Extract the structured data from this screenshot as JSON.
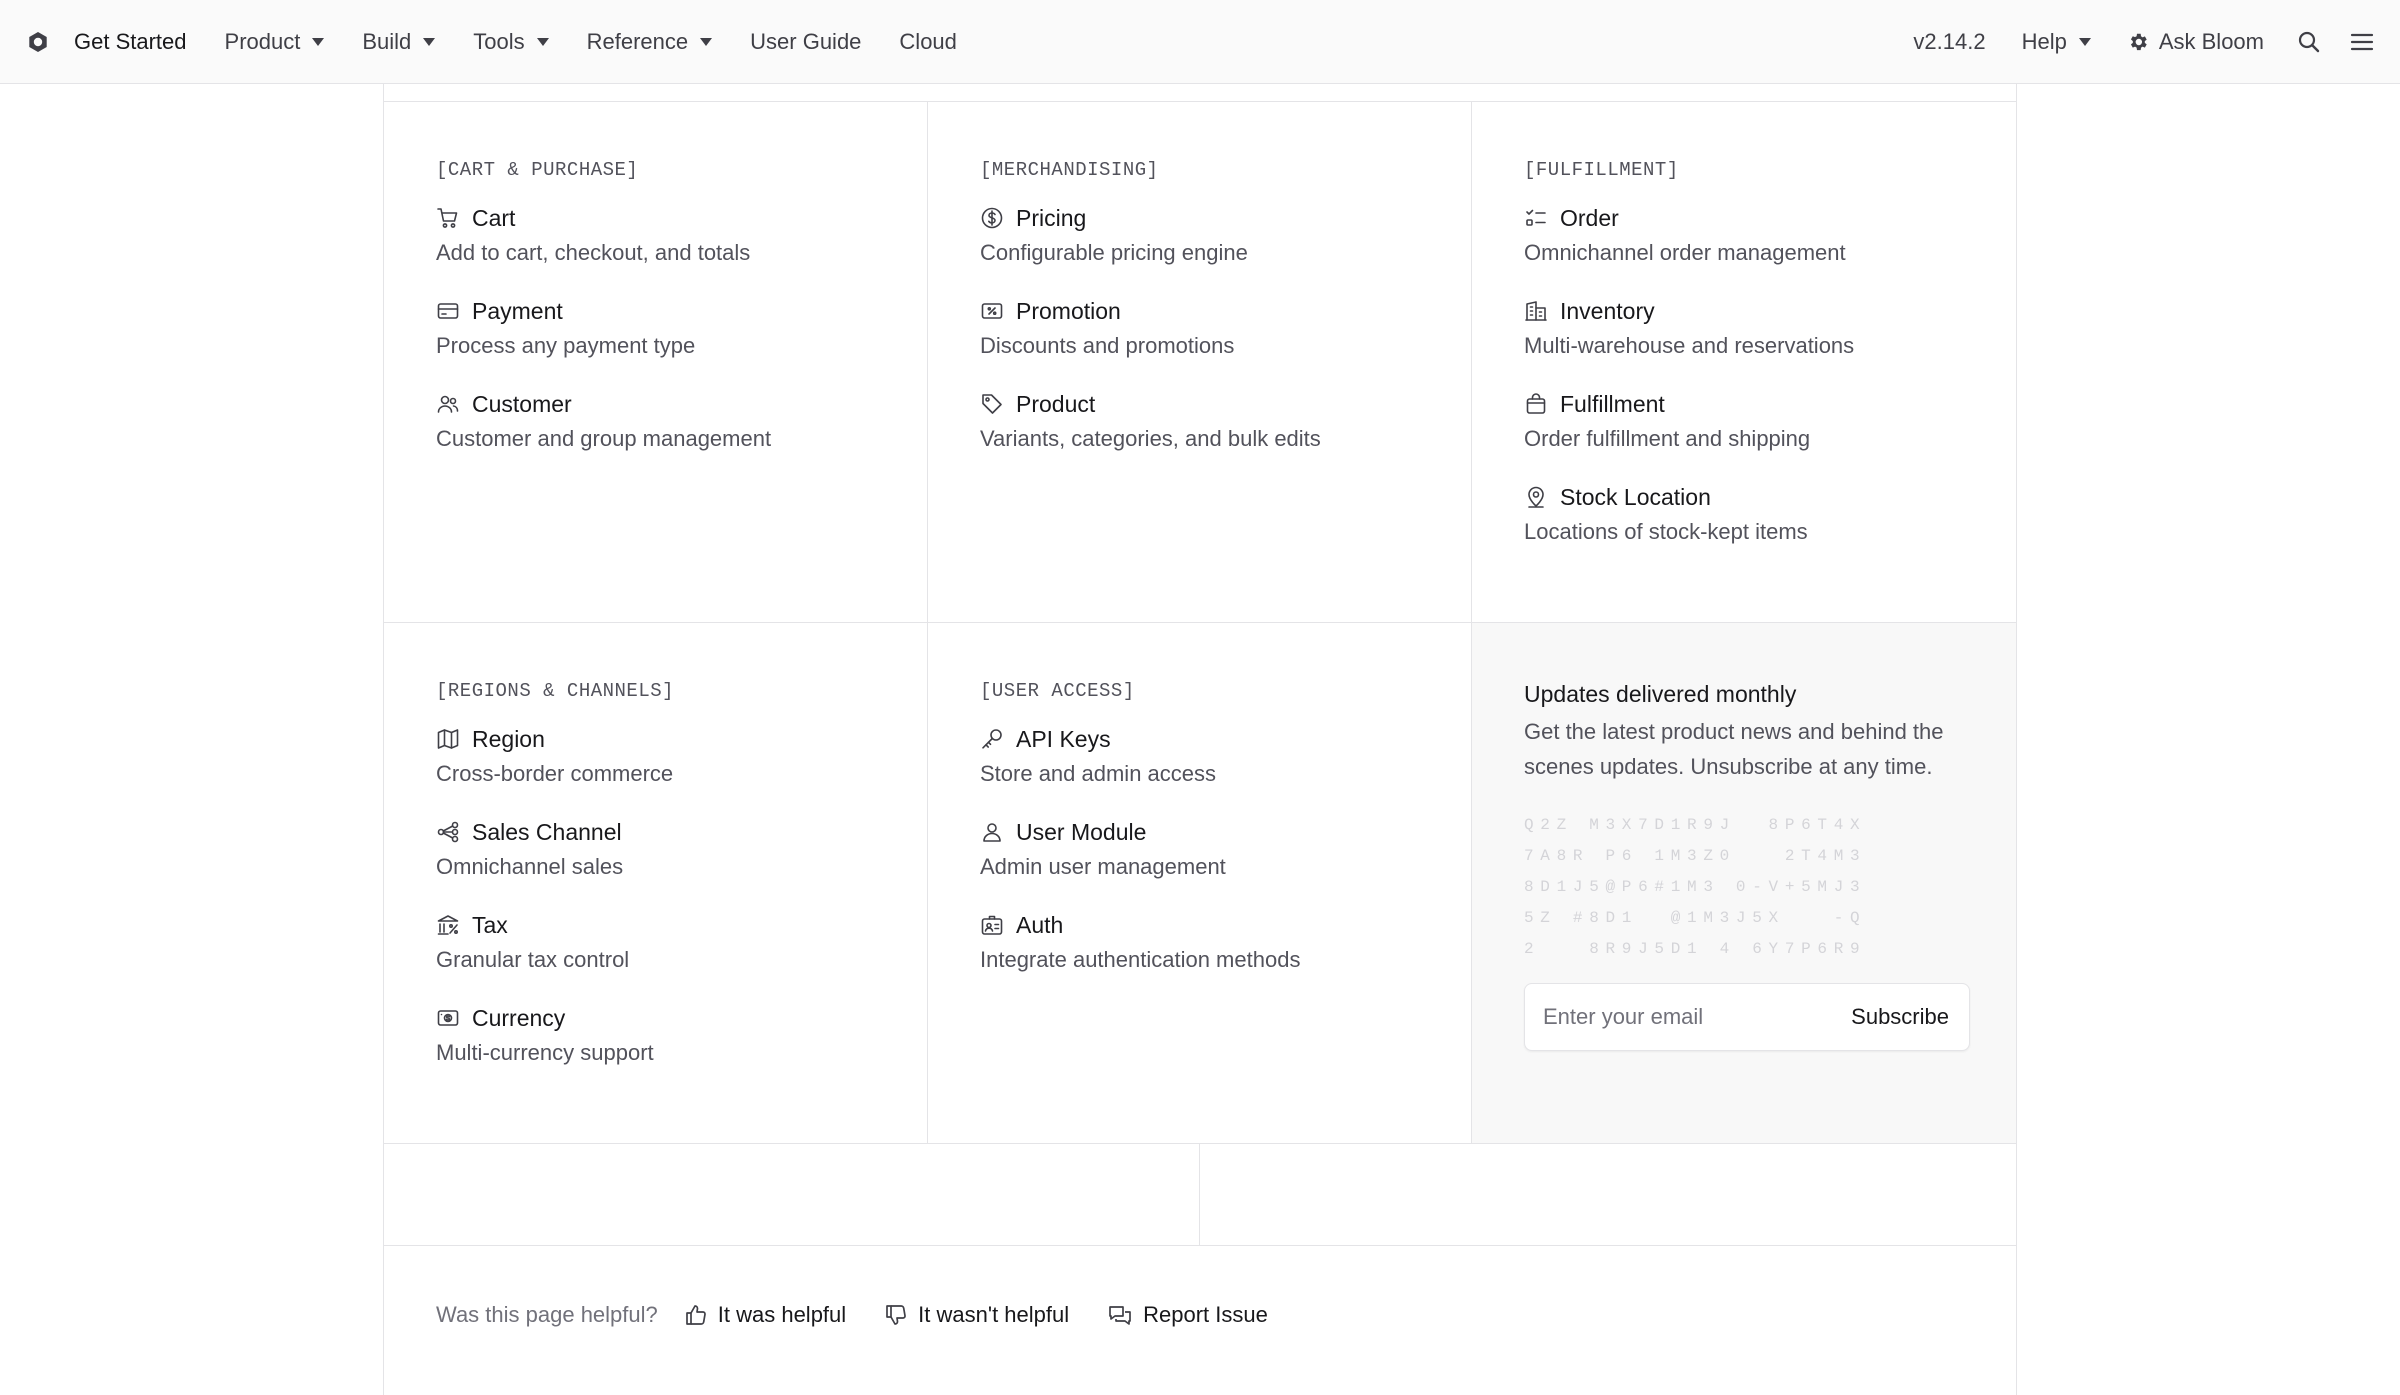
{
  "nav": {
    "left": [
      {
        "label": "Get Started",
        "dropdown": false
      },
      {
        "label": "Product",
        "dropdown": true
      },
      {
        "label": "Build",
        "dropdown": true
      },
      {
        "label": "Tools",
        "dropdown": true
      },
      {
        "label": "Reference",
        "dropdown": true
      },
      {
        "label": "User Guide",
        "dropdown": false
      },
      {
        "label": "Cloud",
        "dropdown": false
      }
    ],
    "version": "v2.14.2",
    "help": "Help",
    "ask": "Ask Bloom"
  },
  "sections": [
    {
      "label": "[CART & PURCHASE]",
      "items": [
        {
          "icon": "cart-icon",
          "title": "Cart",
          "desc": "Add to cart, checkout, and totals"
        },
        {
          "icon": "credit-card-icon",
          "title": "Payment",
          "desc": "Process any payment type"
        },
        {
          "icon": "users-icon",
          "title": "Customer",
          "desc": "Customer and group management"
        }
      ]
    },
    {
      "label": "[MERCHANDISING]",
      "items": [
        {
          "icon": "currency-dollar-icon",
          "title": "Pricing",
          "desc": "Configurable pricing engine"
        },
        {
          "icon": "receipt-percent-icon",
          "title": "Promotion",
          "desc": "Discounts and promotions"
        },
        {
          "icon": "tag-icon",
          "title": "Product",
          "desc": "Variants, categories, and bulk edits"
        }
      ]
    },
    {
      "label": "[FULFILLMENT]",
      "items": [
        {
          "icon": "checklist-icon",
          "title": "Order",
          "desc": "Omnichannel order management"
        },
        {
          "icon": "building-icon",
          "title": "Inventory",
          "desc": "Multi-warehouse and reservations"
        },
        {
          "icon": "shopping-bag-icon",
          "title": "Fulfillment",
          "desc": "Order fulfillment and shipping"
        },
        {
          "icon": "map-pin-icon",
          "title": "Stock Location",
          "desc": "Locations of stock-kept items"
        }
      ]
    },
    {
      "label": "[REGIONS & CHANNELS]",
      "items": [
        {
          "icon": "map-icon",
          "title": "Region",
          "desc": "Cross-border commerce"
        },
        {
          "icon": "channels-icon",
          "title": "Sales Channel",
          "desc": "Omnichannel sales"
        },
        {
          "icon": "building-tax-icon",
          "title": "Tax",
          "desc": "Granular tax control"
        },
        {
          "icon": "cash-icon",
          "title": "Currency",
          "desc": "Multi-currency support"
        }
      ]
    },
    {
      "label": "[USER ACCESS]",
      "items": [
        {
          "icon": "key-icon",
          "title": "API Keys",
          "desc": "Store and admin access"
        },
        {
          "icon": "user-icon",
          "title": "User Module",
          "desc": "Admin user management"
        },
        {
          "icon": "id-badge-icon",
          "title": "Auth",
          "desc": "Integrate authentication methods"
        }
      ]
    }
  ],
  "newsletter": {
    "title": "Updates delivered monthly",
    "body": "Get the latest product news and behind the scenes updates. Unsubscribe at any time.",
    "matrix": [
      "Q2Z M3X7D1R9J  8P6T4X",
      "7A8R P6 1M3Z0   2T4M3",
      "8D1J5@P6#1M3 0-V+5MJ3",
      "5Z #8D1  @1M3J5X   -Q",
      "2   8R9J5D1 4 6Y7P6R9"
    ],
    "email_placeholder": "Enter your email",
    "subscribe_label": "Subscribe"
  },
  "feedback": {
    "question": "Was this page helpful?",
    "helpful": "It was helpful",
    "not_helpful": "It wasn't helpful",
    "report": "Report Issue"
  }
}
